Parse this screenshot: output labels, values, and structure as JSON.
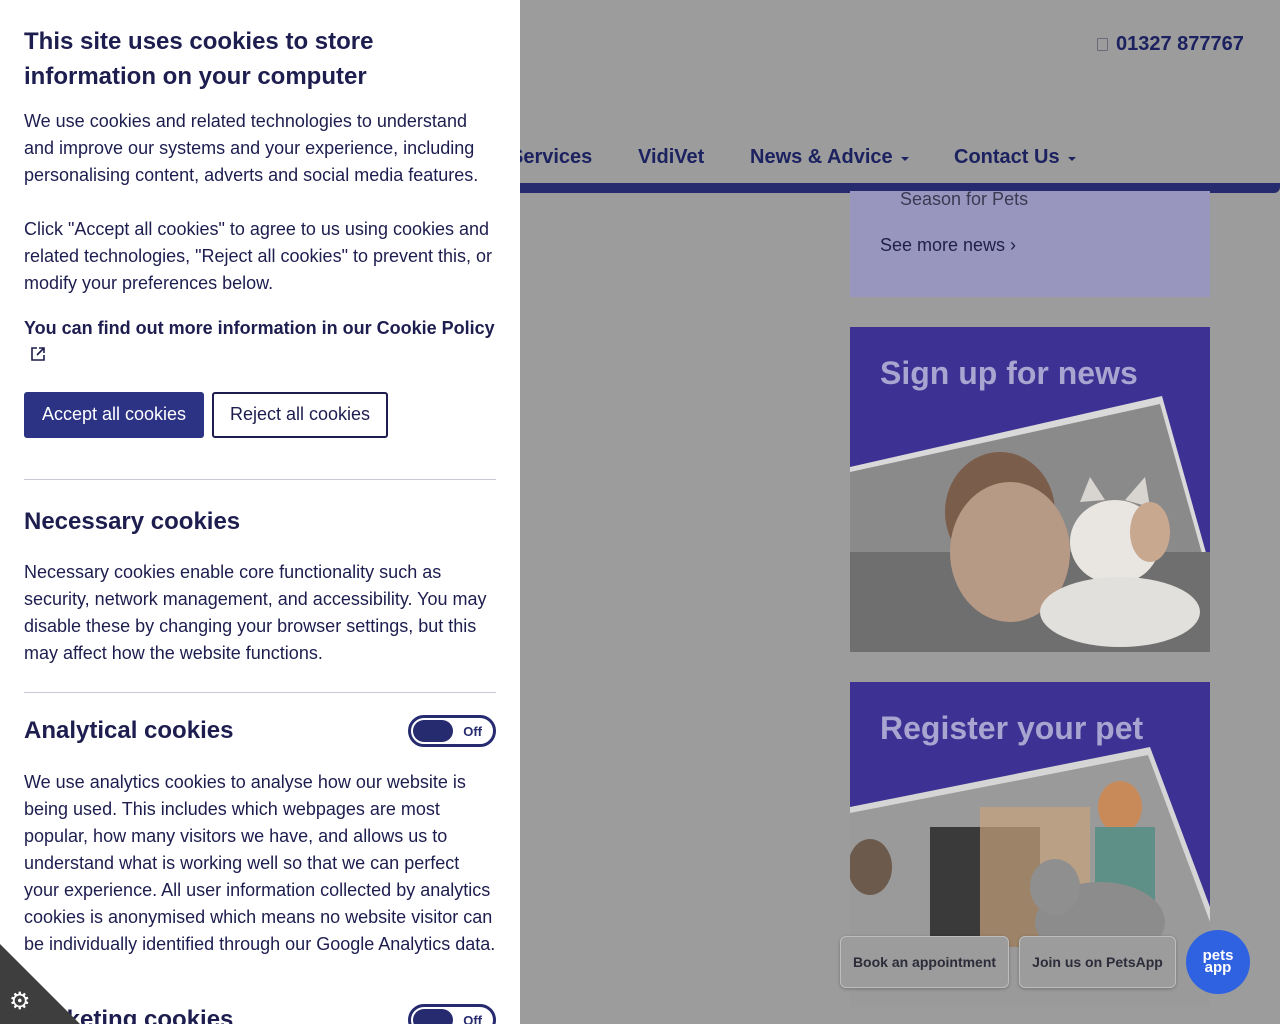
{
  "header": {
    "phone": "01327 877767"
  },
  "nav": {
    "items": [
      {
        "label": "Services",
        "has_dropdown": false
      },
      {
        "label": "VidiVet",
        "has_dropdown": false
      },
      {
        "label": "News & Advice",
        "has_dropdown": true
      },
      {
        "label": "Contact Us",
        "has_dropdown": true
      }
    ]
  },
  "sidebar": {
    "news_item": "Season for Pets",
    "see_more": "See more news ›",
    "signup_title": "Sign up for news",
    "register_title": "Register your pet"
  },
  "floating": {
    "book_label": "Book an appointment",
    "join_label": "Join us on PetsApp",
    "badge_line1": "pets",
    "badge_line2": "app"
  },
  "cookie_banner": {
    "title": "This site uses cookies to store information on your computer",
    "intro": "We use cookies and related technologies to understand and improve our systems and your experience, including personalising content, adverts and social media features.",
    "intro2": "Click \"Accept all cookies\" to agree to us using cookies and related technologies, \"Reject all cookies\" to prevent this, or modify your preferences below.",
    "policy_prefix": "You can find out more information in our ",
    "policy_link": "Cookie Policy",
    "accept_label": "Accept all cookies",
    "reject_label": "Reject all cookies",
    "sections": [
      {
        "title": "Necessary cookies",
        "description": "Necessary cookies enable core functionality such as security, network management, and accessibility. You may disable these by changing your browser settings, but this may affect how the website functions."
      },
      {
        "title": "Analytical cookies",
        "toggle": "Off",
        "description": "We use analytics cookies to analyse how our website is being used. This includes which webpages are most popular, how many visitors we have, and allows us to understand what is working well so that we can perfect your experience. All user information collected by analytics cookies is anonymised which means no website visitor can be individually identified through our Google Analytics data."
      },
      {
        "title": "Marketing cookies",
        "toggle": "Off"
      }
    ]
  },
  "colors": {
    "brand_navy": "#262a6e",
    "accept_button": "#2c3384",
    "promo_purple": "#3d3193",
    "petsapp_blue": "#2f62e0"
  }
}
